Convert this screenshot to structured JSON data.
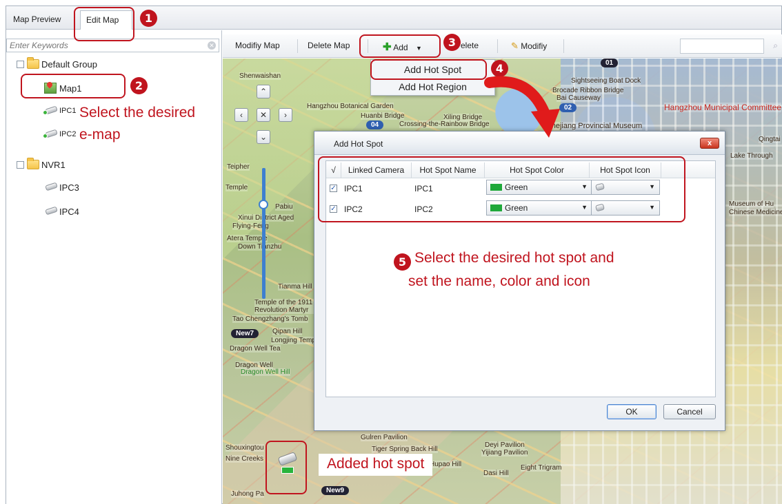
{
  "tabs": [
    {
      "label": "Map Preview",
      "active": false
    },
    {
      "label": "Edit Map",
      "active": true
    }
  ],
  "search": {
    "placeholder": "Enter Keywords",
    "clear_icon": "clear-icon"
  },
  "tree": {
    "groups": [
      {
        "name": "Default Group",
        "expanded": true,
        "children": [
          {
            "name": "Map1",
            "type": "map",
            "selected": true
          },
          {
            "name": "IPC1",
            "type": "camera"
          },
          {
            "name": "IPC2",
            "type": "camera"
          }
        ]
      },
      {
        "name": "NVR1",
        "expanded": true,
        "children": [
          {
            "name": "IPC3",
            "type": "camera"
          },
          {
            "name": "IPC4",
            "type": "camera"
          }
        ]
      }
    ],
    "expander_symbol": "⊟"
  },
  "toolbar": {
    "modify_map": "Modifiy Map",
    "delete_map": "Delete Map",
    "add": "Add",
    "delete": "elete",
    "modify": "Modifiy"
  },
  "add_menu": {
    "items": [
      "Add Hot Spot",
      "Add Hot Region"
    ]
  },
  "map": {
    "badges": [
      "01",
      "02",
      "04",
      "New7",
      "New9"
    ],
    "labels": [
      "Shenwaishan",
      "Sightseeing Boat Dock",
      "Brocade Ribbon Bridge",
      "Bai Causeway",
      "Hangzhou Botanical Garden",
      "Huanbi Bridge",
      "Xiling Bridge",
      "Crossing-the-Rainbow Bridge",
      "Zhejiang Provincial Museum",
      "Hangzhou Municipal Committee",
      "Qingtai",
      "Lake Through",
      "Teipher",
      "Temple",
      "Xinui District Aged",
      "Flying-Feng",
      "Pabiu",
      "Atera Temple",
      "Down Tianzhu",
      "Tianma Hill",
      "Temple of the 1911 Revolution Martyr",
      "Tao Chengzhang's Tomb",
      "Qipan Hill",
      "Longjing Temple",
      "Dragon Well Tea",
      "Dragon Well",
      "Dragon Well Hill",
      "Shouxingtou",
      "Nine Creeks",
      "Tiger Spring Back Hill",
      "Deyi Pavilion",
      "Yijiang Pavilion",
      "Hupao Hill",
      "Dasi Hill",
      "Eight Trigram",
      "Gulren Pavilion",
      "Juhong Pa",
      "Museum of Hu",
      "Chinese Medicine"
    ]
  },
  "dialog": {
    "title": "Add Hot Spot",
    "close": "x",
    "columns": [
      "√",
      "Linked Camera",
      "Hot Spot Name",
      "Hot Spot Color",
      "Hot Spot Icon"
    ],
    "rows": [
      {
        "checked": true,
        "camera": "IPC1",
        "name": "IPC1",
        "color": "Green",
        "color_hex": "#1fa83a",
        "icon": "camera-icon"
      },
      {
        "checked": true,
        "camera": "IPC2",
        "name": "IPC2",
        "color": "Green",
        "color_hex": "#1fa83a",
        "icon": "camera-icon"
      }
    ],
    "ok": "OK",
    "cancel": "Cancel"
  },
  "annotations": {
    "n1": "1",
    "n2": "2",
    "n3": "3",
    "n4": "4",
    "n5": "5",
    "select_map_line1": "Select the desired",
    "select_map_line2": "e-map",
    "step5_line1": "Select the desired hot spot and",
    "step5_line2": "set the name, color and icon",
    "added_hot_spot": "Added hot spot",
    "accent": "#c0141e"
  }
}
